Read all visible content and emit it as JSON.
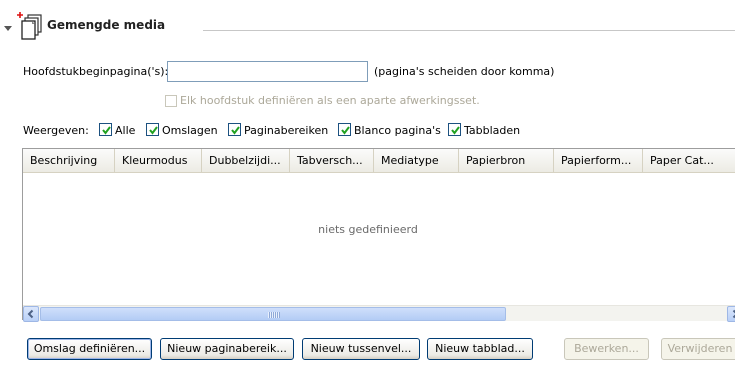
{
  "section": {
    "title": "Gemengde media",
    "icon": "mixed-media-document-icon"
  },
  "chapter": {
    "label": "Hoofdstukbeginpagina('s):",
    "value": "",
    "hint": "(pagina's scheiden door komma)",
    "finishing_label": "Elk hoofdstuk definiëren als een aparte afwerkingsset.",
    "finishing_checked": false
  },
  "show": {
    "label": "Weergeven:",
    "options": [
      {
        "label": "Alle",
        "checked": true
      },
      {
        "label": "Omslagen",
        "checked": true
      },
      {
        "label": "Paginabereiken",
        "checked": true
      },
      {
        "label": "Blanco pagina's",
        "checked": true
      },
      {
        "label": "Tabbladen",
        "checked": true
      }
    ]
  },
  "table": {
    "columns": [
      "Beschrijving",
      "Kleurmodus",
      "Dubbelzijdi...",
      "Tabversch...",
      "Mediatype",
      "Papierbron",
      "Papierform...",
      "Paper Cat..."
    ],
    "empty_message": "niets gedefinieerd"
  },
  "buttons": {
    "define_cover": "Omslag definiëren...",
    "new_page_range": "Nieuw paginabereik...",
    "new_insert": "Nieuw tussenvel...",
    "new_tab": "Nieuw tabblad...",
    "edit": "Bewerken...",
    "delete": "Verwijderen"
  },
  "colors": {
    "checkbox_border": "#1c5180",
    "checkmark": "#21a121",
    "button_border": "#003c74",
    "disabled_text": "#aca899"
  }
}
